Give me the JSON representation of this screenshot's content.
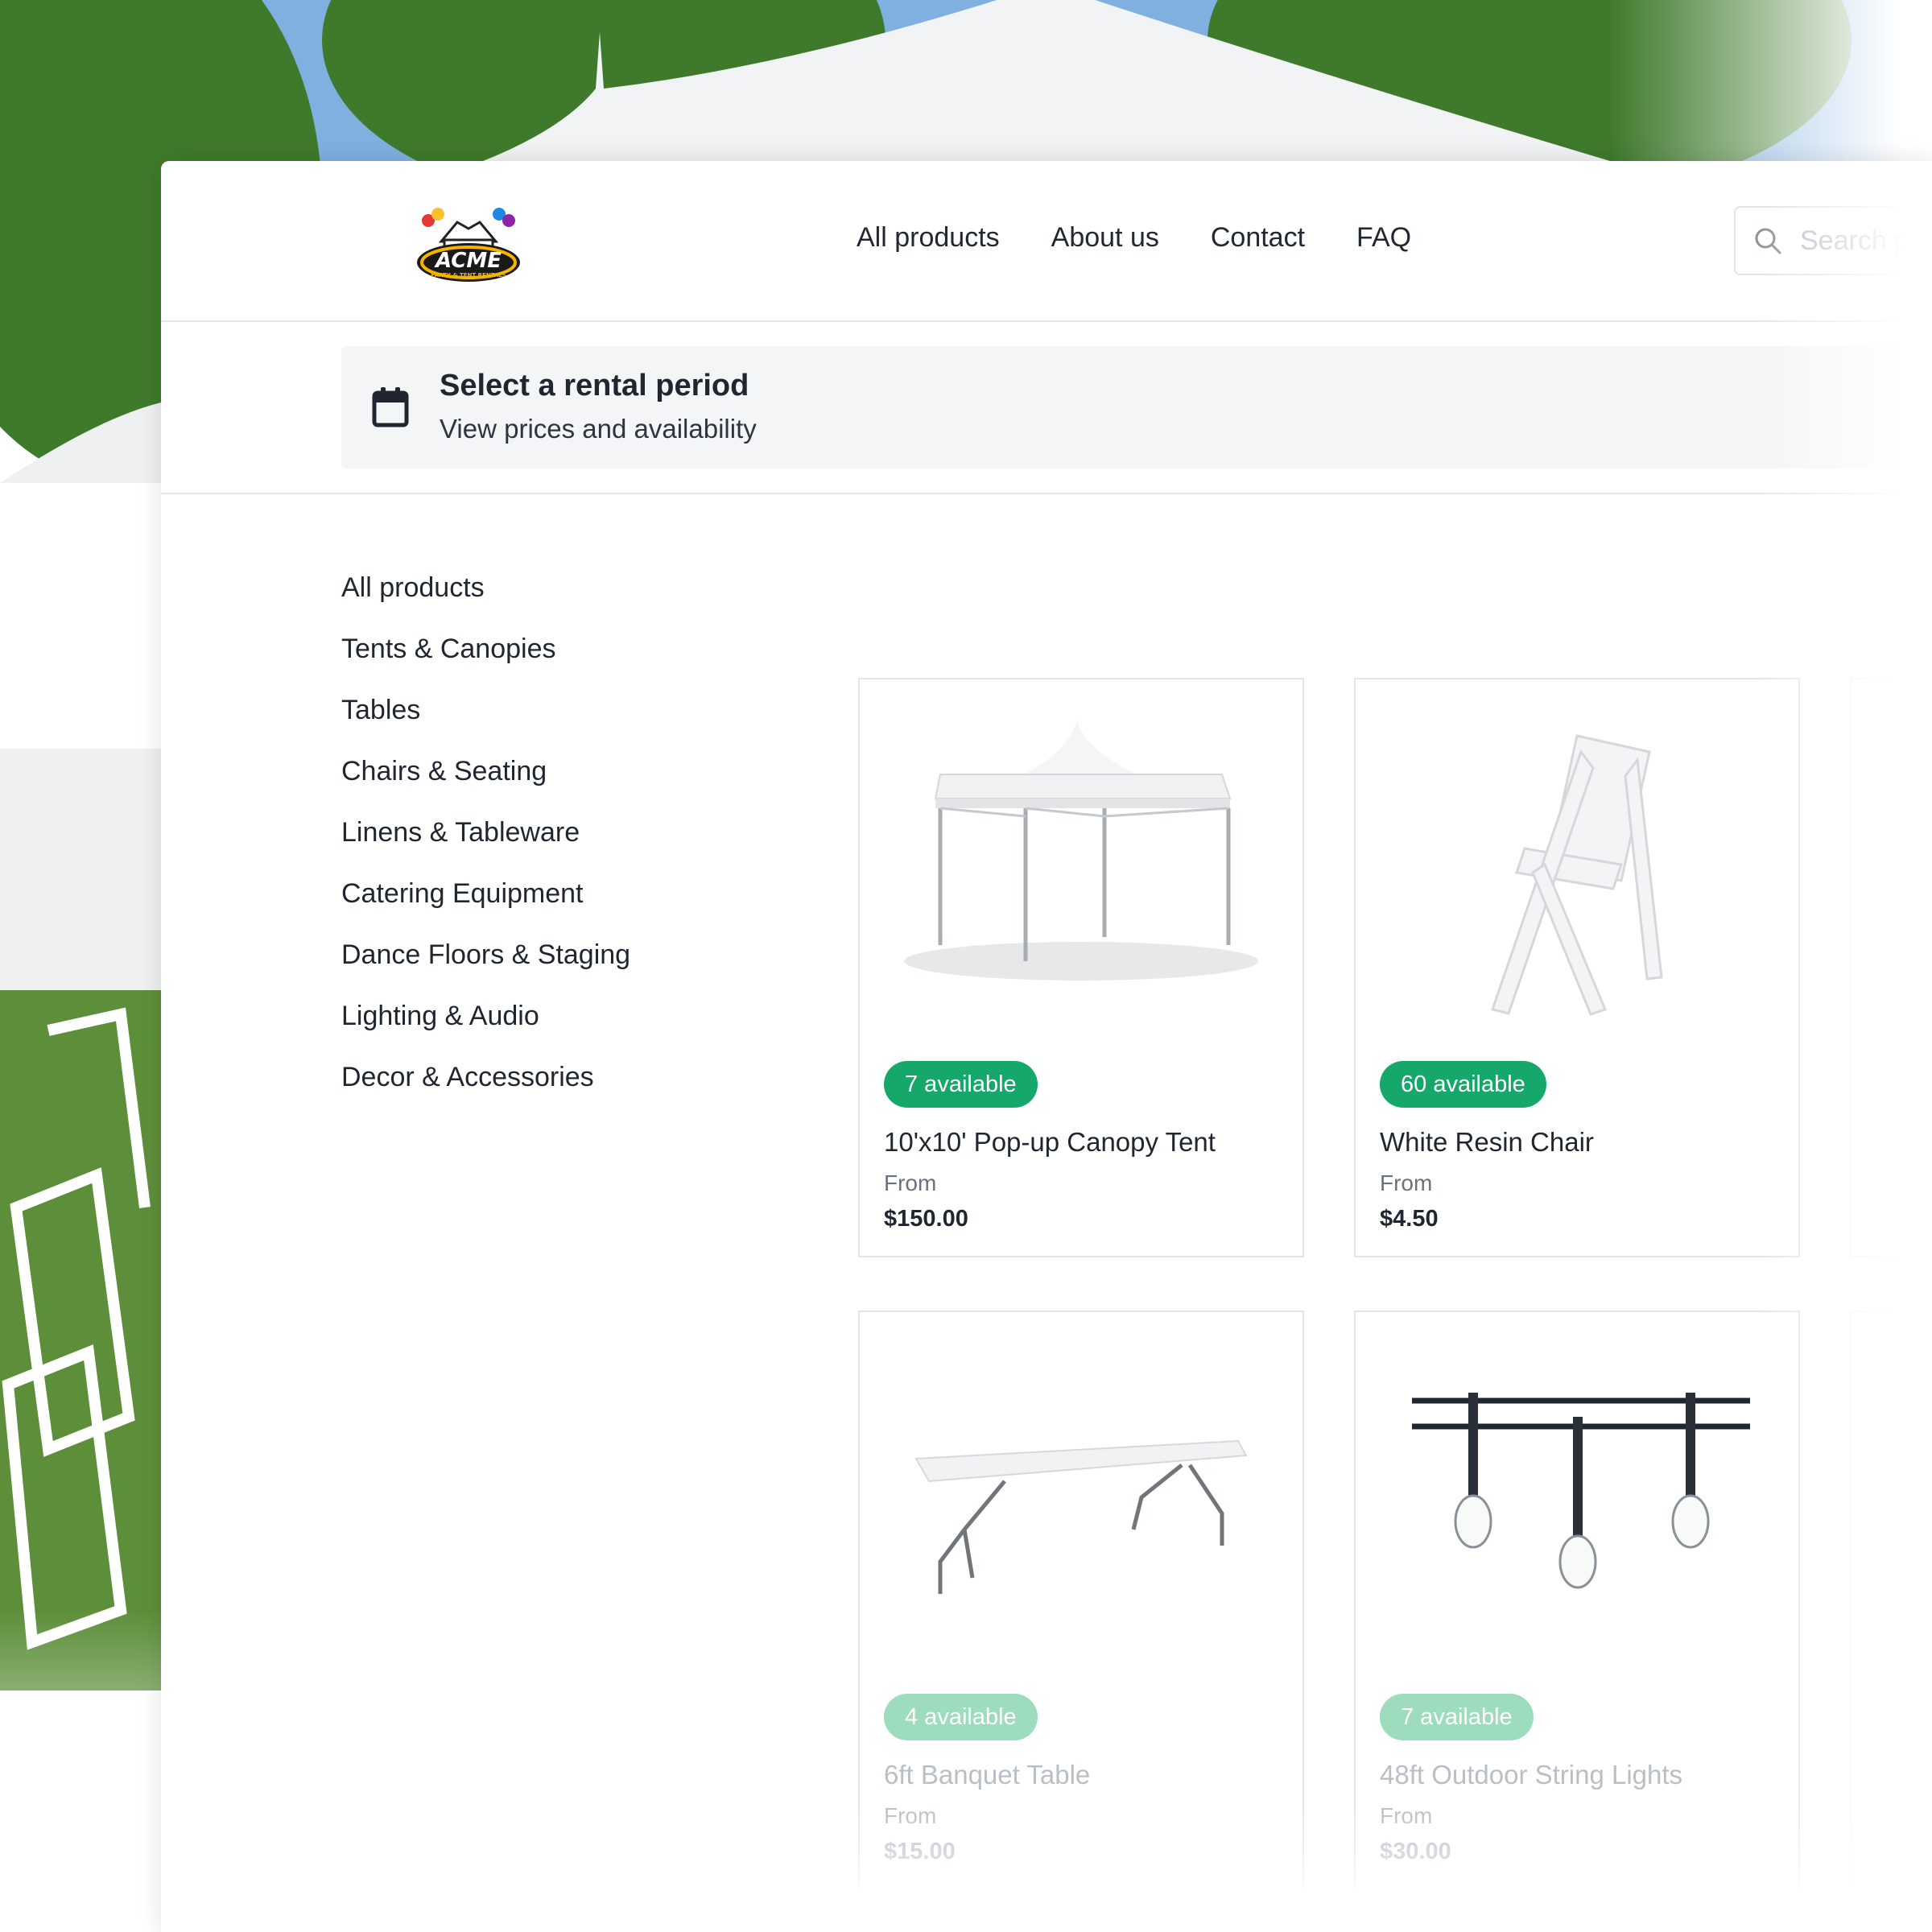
{
  "header": {
    "logo_text": "ACME",
    "logo_subtext": "PARTY & TENT RENTALS",
    "nav": [
      {
        "label": "All products"
      },
      {
        "label": "About us"
      },
      {
        "label": "Contact"
      },
      {
        "label": "FAQ"
      }
    ],
    "search_placeholder": "Search products"
  },
  "rental_period": {
    "title": "Select a rental period",
    "subtitle": "View prices and availability",
    "icon": "calendar-icon"
  },
  "categories": [
    {
      "label": "All products"
    },
    {
      "label": "Tents & Canopies"
    },
    {
      "label": "Tables"
    },
    {
      "label": "Chairs & Seating"
    },
    {
      "label": "Linens & Tableware"
    },
    {
      "label": "Catering Equipment"
    },
    {
      "label": "Dance Floors & Staging"
    },
    {
      "label": "Lighting & Audio"
    },
    {
      "label": "Decor & Accessories"
    }
  ],
  "products": [
    {
      "badge": "7 available",
      "name": "10'x10' Pop-up Canopy Tent",
      "from_label": "From",
      "price": "$150.00",
      "image": "canopy-tent"
    },
    {
      "badge": "60 available",
      "name": "White Resin Chair",
      "from_label": "From",
      "price": "$4.50",
      "image": "folding-chair"
    },
    {
      "badge": "4 available",
      "name": "6ft Banquet Table",
      "from_label": "From",
      "price": "$15.00",
      "image": "banquet-table"
    },
    {
      "badge": "7 available",
      "name": "48ft Outdoor String Lights",
      "from_label": "From",
      "price": "$30.00",
      "image": "string-lights"
    }
  ],
  "colors": {
    "badge_green": "#16a86a",
    "text_dark": "#1f2630",
    "panel_bg": "#f3f5f7"
  }
}
